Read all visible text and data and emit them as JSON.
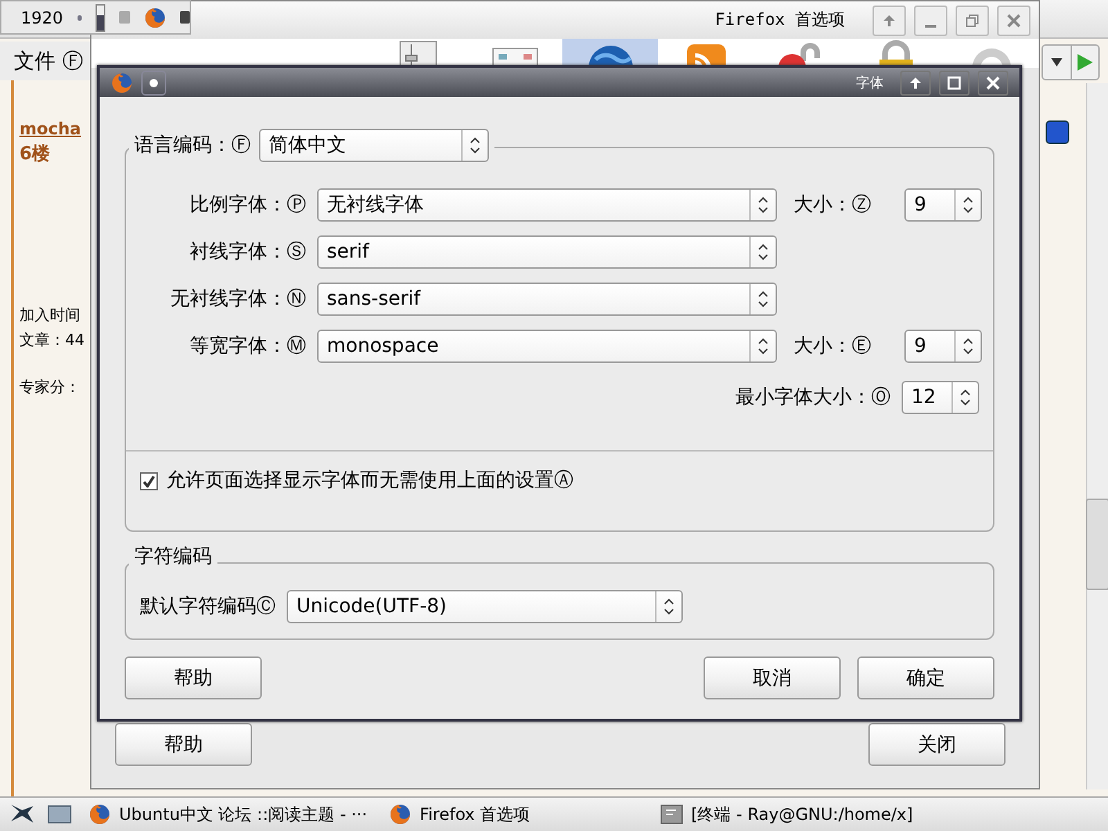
{
  "panel": {
    "clock": "1920"
  },
  "browser": {
    "menu": [
      {
        "label": "文件 Ⓕ"
      }
    ],
    "post": {
      "author": "mocha",
      "floor": "6楼",
      "info": [
        "加入时间",
        "文章：44",
        "专家分："
      ]
    }
  },
  "prefs_window": {
    "title": "Firefox 首选项",
    "categories": [
      {
        "kind": "sliders",
        "selected": false
      },
      {
        "kind": "tabs",
        "selected": false
      },
      {
        "kind": "globe",
        "selected": true
      },
      {
        "kind": "feed",
        "selected": false
      },
      {
        "kind": "unlock",
        "selected": false
      },
      {
        "kind": "lock",
        "selected": false
      },
      {
        "kind": "gear",
        "selected": false
      }
    ],
    "buttons": [
      {
        "label": "帮助"
      },
      {
        "label": "关闭"
      }
    ]
  },
  "font_dialog": {
    "title": "字体",
    "language": {
      "label": "语言编码：Ⓕ",
      "value": "简体中文"
    },
    "rows": [
      {
        "label": "比例字体：Ⓟ",
        "value": "无衬线字体",
        "size_label": "大小：Ⓩ",
        "size": "9"
      },
      {
        "label": "衬线字体：Ⓢ",
        "value": "serif"
      },
      {
        "label": "无衬线字体：Ⓝ",
        "value": "sans-serif"
      },
      {
        "label": "等宽字体：Ⓜ",
        "value": "monospace",
        "size_label": "大小：Ⓔ",
        "size": "9"
      }
    ],
    "min_size": {
      "label": "最小字体大小：Ⓞ",
      "value": "12"
    },
    "allow": {
      "label": "允许页面选择显示字体而无需使用上面的设置Ⓐ",
      "checked": true
    },
    "encoding": {
      "title": "字符编码",
      "label": "默认字符编码Ⓒ",
      "value": "Unicode(UTF-8)"
    },
    "buttons": [
      {
        "label": "帮助"
      },
      {
        "label": "取消"
      },
      {
        "label": "确定"
      }
    ]
  },
  "taskbar": [
    {
      "kind": "firefox",
      "label": "Ubuntu中文 论坛 ::阅读主题 - ···"
    },
    {
      "kind": "firefox",
      "label": "Firefox 首选项"
    },
    {
      "kind": "terminal",
      "label": "[终端 - Ray@GNU:/home/x]"
    }
  ]
}
